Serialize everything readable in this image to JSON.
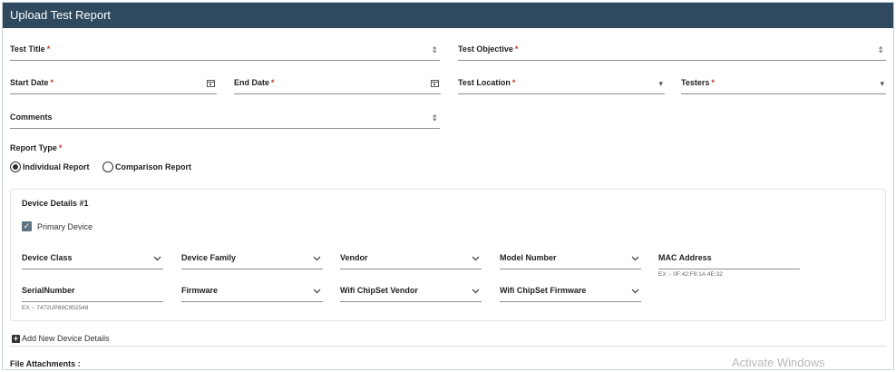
{
  "header": {
    "title": "Upload Test Report"
  },
  "form": {
    "required_mark": "*",
    "test_title": {
      "label": "Test Title"
    },
    "test_objective": {
      "label": "Test Objective"
    },
    "start_date": {
      "label": "Start Date"
    },
    "end_date": {
      "label": "End Date"
    },
    "test_location": {
      "label": "Test Location"
    },
    "testers": {
      "label": "Testers"
    },
    "comments": {
      "label": "Comments"
    },
    "report_type": {
      "label": "Report Type",
      "options": [
        "Individual Report",
        "Comparison Report"
      ],
      "selected": "Individual Report"
    }
  },
  "device": {
    "title": "Device Details #1",
    "primary_label": "Primary Device",
    "primary_checked": true,
    "fields": {
      "device_class": "Device Class",
      "device_family": "Device Family",
      "vendor": "Vendor",
      "model_number": "Model Number",
      "mac_address": "MAC Address",
      "serial_number": "SerialNumber",
      "firmware": "Firmware",
      "wifi_vendor": "Wifi ChipSet Vendor",
      "wifi_firmware": "Wifi ChipSet Firmware"
    },
    "hints": {
      "mac": "EX :- 0F:42:F8:1A:4E:32",
      "serial": "EX :- 7472UP89C952548"
    }
  },
  "add_device": {
    "label": "Add New Device Details"
  },
  "file_attachments": {
    "label": "File Attachments :"
  },
  "watermark": {
    "text": "Activate Windows"
  },
  "icons": {
    "spinner": "⇕",
    "calendar": "📅",
    "caret": "▾",
    "chevron": "⌄",
    "check": "✓",
    "plus": "+"
  }
}
